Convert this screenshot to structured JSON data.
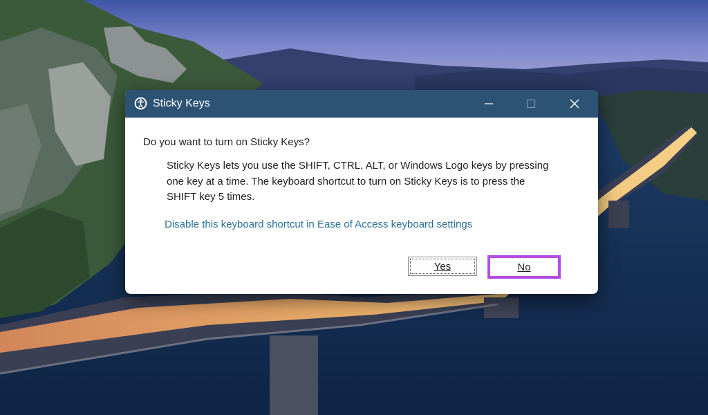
{
  "window": {
    "title": "Sticky Keys",
    "icon": "accessibility-icon"
  },
  "window_controls": {
    "minimize_icon": "minimize-icon",
    "maximize_icon": "maximize-icon",
    "close_icon": "close-icon"
  },
  "dialog": {
    "question": "Do you want to turn on Sticky Keys?",
    "explanation_lines": [
      "Sticky Keys lets you use the SHIFT, CTRL, ALT, or Windows Logo keys by pressing",
      "one key at a time. The keyboard shortcut to turn on Sticky Keys is to press the",
      "SHIFT key 5 times."
    ],
    "link": "Disable this keyboard shortcut in Ease of Access keyboard settings",
    "yes_label": "Yes",
    "no_label": "No"
  },
  "colors": {
    "titlebar": "#2c5374",
    "link": "#2a6f9a",
    "highlight": "#b44ee0"
  }
}
